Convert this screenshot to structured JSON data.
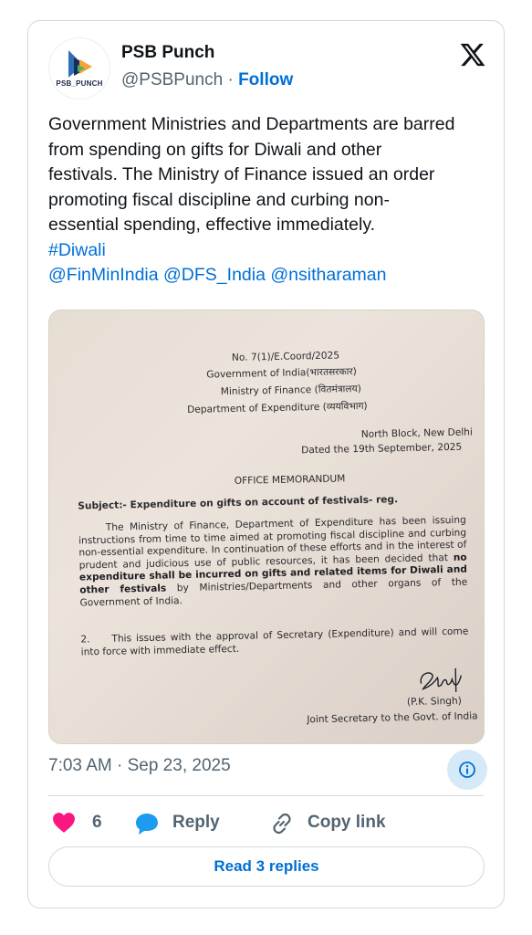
{
  "author": {
    "name": "PSB Punch",
    "handle": "@PSBPunch",
    "separator": "·",
    "follow_label": "Follow",
    "avatar_text": "PSB_PUNCH"
  },
  "tweet": {
    "lines": [
      "Government Ministries and Departments are barred",
      "from spending on gifts for Diwali and other",
      "festivals. The Ministry of Finance issued an order",
      "promoting fiscal discipline and curbing non-",
      "essential spending, effective immediately."
    ],
    "hashtag": "#Diwali",
    "mentions": [
      "@FinMinIndia",
      "@DFS_India",
      "@nsitharaman"
    ]
  },
  "document": {
    "number": "No. 7(1)/E.Coord/2025",
    "govt": "Government of India(भारतसरकार)",
    "ministry": "Ministry of Finance (वितमंत्रालय)",
    "department": "Department of Expenditure (व्ययविभाग)",
    "location": "North Block, New Delhi",
    "date": "Dated the 19th September, 2025",
    "heading": "OFFICE MEMORANDUM",
    "subject_prefix": "Subject:-",
    "subject": "Expenditure on gifts on account of festivals- reg.",
    "para1_a": "The Ministry of Finance, Department of Expenditure has been issuing instructions from time to time aimed at promoting fiscal discipline and curbing non-essential expenditure. In continuation of these efforts and in the interest of prudent and judicious use of public resources, it has been decided that",
    "para1_bold": "no expenditure shall be incurred on gifts and related items for Diwali and other festivals",
    "para1_b": "by Ministries/Departments and other organs of the Government of India.",
    "para2_num": "2.",
    "para2": "This issues with the approval of Secretary (Expenditure) and will come into force with immediate effect.",
    "signatory": "(P.K. Singh)",
    "designation": "Joint Secretary to the Govt. of India"
  },
  "footer": {
    "timestamp": "7:03 AM · Sep 23, 2025",
    "likes": "6",
    "reply_label": "Reply",
    "copy_label": "Copy link",
    "read_replies": "Read 3 replies"
  },
  "colors": {
    "accent": "#006fd6",
    "like": "#f91880",
    "muted": "#536471",
    "border": "#cfd9de"
  },
  "icons": [
    "x-logo-icon",
    "info-icon",
    "heart-icon",
    "reply-bubble-icon",
    "link-icon"
  ]
}
